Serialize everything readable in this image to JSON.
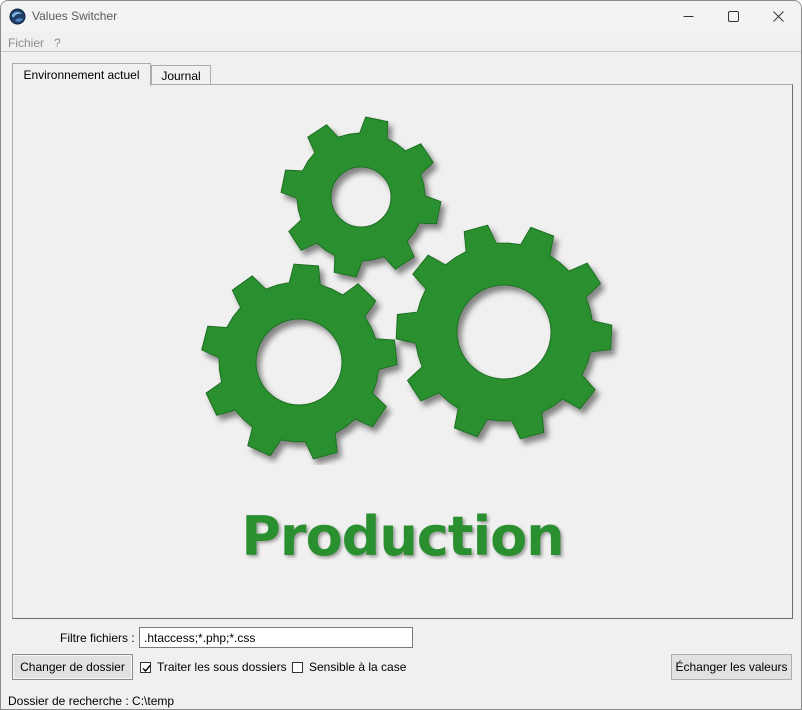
{
  "window": {
    "title": "Values Switcher"
  },
  "menu": {
    "items": [
      "Fichier",
      "?"
    ]
  },
  "tabs": [
    {
      "label": "Environnement actuel",
      "active": true
    },
    {
      "label": "Journal",
      "active": false
    }
  ],
  "environment": {
    "name": "Production",
    "icon": "gears-icon",
    "color": "#2a8f2f"
  },
  "filter": {
    "label": "Filtre fichiers :",
    "value": ".htaccess;*.php;*.css"
  },
  "buttons": {
    "change_folder": "Changer de dossier",
    "swap_values": "Échanger les valeurs"
  },
  "options": {
    "subfolders": {
      "label": "Traiter les sous dossiers",
      "checked": true
    },
    "case_sensitive": {
      "label": "Sensible à la case",
      "checked": false
    }
  },
  "status": {
    "text": "Dossier de recherche : C:\\temp"
  }
}
